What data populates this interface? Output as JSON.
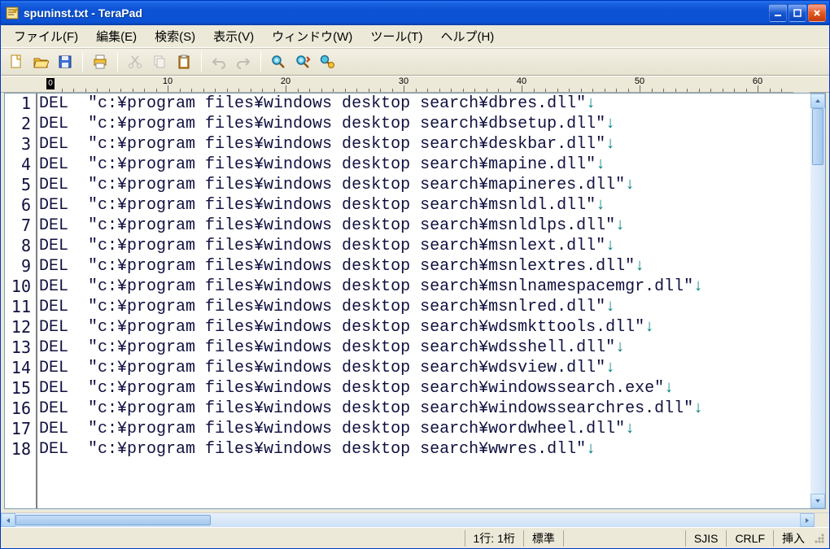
{
  "window": {
    "title": "spuninst.txt - TeraPad"
  },
  "menu": {
    "file": "ファイル(F)",
    "edit": "編集(E)",
    "search": "検索(S)",
    "view": "表示(V)",
    "window": "ウィンドウ(W)",
    "tool": "ツール(T)",
    "help": "ヘルプ(H)"
  },
  "ruler": {
    "origin": "0",
    "marks": [
      "10",
      "20",
      "30",
      "40",
      "50",
      "60"
    ]
  },
  "editor": {
    "lines": [
      "DEL  \"c:¥program files¥windows desktop search¥dbres.dll\"",
      "DEL  \"c:¥program files¥windows desktop search¥dbsetup.dll\"",
      "DEL  \"c:¥program files¥windows desktop search¥deskbar.dll\"",
      "DEL  \"c:¥program files¥windows desktop search¥mapine.dll\"",
      "DEL  \"c:¥program files¥windows desktop search¥mapineres.dll\"",
      "DEL  \"c:¥program files¥windows desktop search¥msnldl.dll\"",
      "DEL  \"c:¥program files¥windows desktop search¥msnldlps.dll\"",
      "DEL  \"c:¥program files¥windows desktop search¥msnlext.dll\"",
      "DEL  \"c:¥program files¥windows desktop search¥msnlextres.dll\"",
      "DEL  \"c:¥program files¥windows desktop search¥msnlnamespacemgr.dll\"",
      "DEL  \"c:¥program files¥windows desktop search¥msnlred.dll\"",
      "DEL  \"c:¥program files¥windows desktop search¥wdsmkttools.dll\"",
      "DEL  \"c:¥program files¥windows desktop search¥wdsshell.dll\"",
      "DEL  \"c:¥program files¥windows desktop search¥wdsview.dll\"",
      "DEL  \"c:¥program files¥windows desktop search¥windowssearch.exe\"",
      "DEL  \"c:¥program files¥windows desktop search¥windowssearchres.dll\"",
      "DEL  \"c:¥program files¥windows desktop search¥wordwheel.dll\"",
      "DEL  \"c:¥program files¥windows desktop search¥wwres.dll\""
    ]
  },
  "status": {
    "pos": " 1行:   1桁",
    "mode": "標準",
    "blank1": "",
    "encoding": "SJIS",
    "newline": "CRLF",
    "insert": "挿入"
  }
}
